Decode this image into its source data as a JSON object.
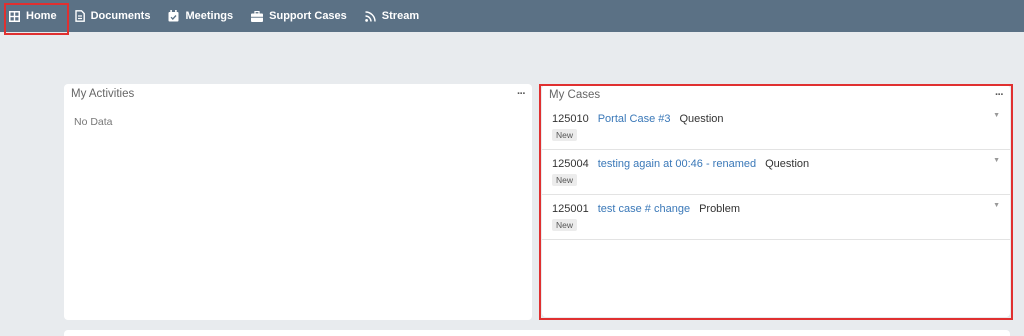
{
  "nav": {
    "items": [
      {
        "label": "Home",
        "icon": "grid-icon"
      },
      {
        "label": "Documents",
        "icon": "document-icon"
      },
      {
        "label": "Meetings",
        "icon": "calendar-icon"
      },
      {
        "label": "Support Cases",
        "icon": "briefcase-icon"
      },
      {
        "label": "Stream",
        "icon": "rss-icon"
      }
    ]
  },
  "activities": {
    "title": "My Activities",
    "menu": "···",
    "empty": "No Data"
  },
  "cases": {
    "title": "My Cases",
    "menu": "···",
    "rows": [
      {
        "number": "125010",
        "name": "Portal Case #3",
        "type": "Question",
        "status": "New"
      },
      {
        "number": "125004",
        "name": "testing again at 00:46 - renamed",
        "type": "Question",
        "status": "New"
      },
      {
        "number": "125001",
        "name": "test case # change",
        "type": "Problem",
        "status": "New"
      }
    ]
  },
  "colors": {
    "navbar": "#5b7185",
    "link": "#3a78b8",
    "highlight": "#e03030",
    "background": "#e8ebee"
  }
}
